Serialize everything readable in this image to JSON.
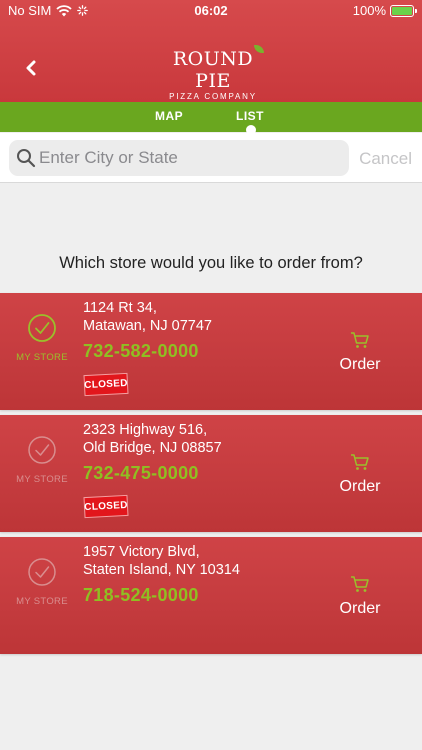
{
  "status_bar": {
    "carrier": "No SIM",
    "time": "06:02",
    "battery": "100%"
  },
  "header": {
    "logo_main": "ROUND PIE",
    "logo_sub": "PIZZA COMPANY"
  },
  "tabs": [
    {
      "label": "MAP",
      "selected": false
    },
    {
      "label": "LIST",
      "selected": true
    }
  ],
  "search": {
    "placeholder": "Enter City or State",
    "value": "",
    "cancel_label": "Cancel"
  },
  "prompt": "Which store would you like to order from?",
  "stores": [
    {
      "address_line1": "1124 Rt 34,",
      "address_line2": "Matawan, NJ 07747",
      "phone": "732-582-0000",
      "status": "CLOSED",
      "my_store_label": "MY STORE",
      "my_store_active": true,
      "order_label": "Order"
    },
    {
      "address_line1": "2323 Highway 516,",
      "address_line2": "Old Bridge, NJ 08857",
      "phone": "732-475-0000",
      "status": "CLOSED",
      "my_store_label": "MY STORE",
      "my_store_active": false,
      "order_label": "Order"
    },
    {
      "address_line1": "1957 Victory Blvd,",
      "address_line2": "Staten Island, NY 10314",
      "phone": "718-524-0000",
      "status": "",
      "my_store_label": "MY STORE",
      "my_store_active": false,
      "order_label": "Order"
    }
  ],
  "colors": {
    "header_red": "#d64a4c",
    "tab_green": "#6aa71f",
    "phone_green": "#8fbf22",
    "closed_red": "#e2161c"
  },
  "icons": {
    "back": "chevron-left-icon",
    "search": "search-icon",
    "check": "check-circle-icon",
    "cart": "cart-icon"
  }
}
